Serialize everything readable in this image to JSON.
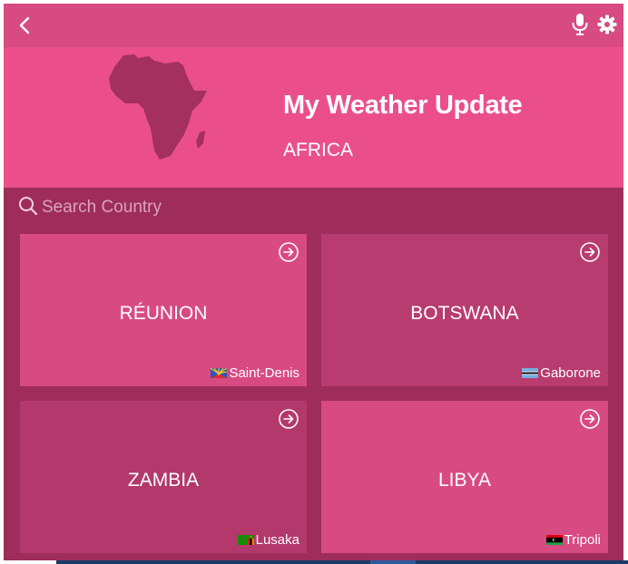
{
  "header": {
    "back_icon": "chevron-left-icon",
    "mic_icon": "microphone-icon",
    "settings_icon": "gear-icon",
    "bar_color": "#d74a82"
  },
  "hero": {
    "title": "My Weather Update",
    "region": "AFRICA",
    "map_icon": "africa-map-icon",
    "background": "#ea4f8c"
  },
  "search": {
    "placeholder": "Search Country",
    "value": "",
    "icon": "search-icon"
  },
  "countries": [
    {
      "name": "RÉUNION",
      "capital": "Saint-Denis",
      "flag": "reunion-flag-icon"
    },
    {
      "name": "BOTSWANA",
      "capital": "Gaborone",
      "flag": "botswana-flag-icon"
    },
    {
      "name": "ZAMBIA",
      "capital": "Lusaka",
      "flag": "zambia-flag-icon"
    },
    {
      "name": "LIBYA",
      "capital": "Tripoli",
      "flag": "libya-flag-icon"
    }
  ],
  "colors": {
    "app_background": "#9e2d5b",
    "card_light": "#d84a82",
    "card_dark": "#b83c6f"
  }
}
